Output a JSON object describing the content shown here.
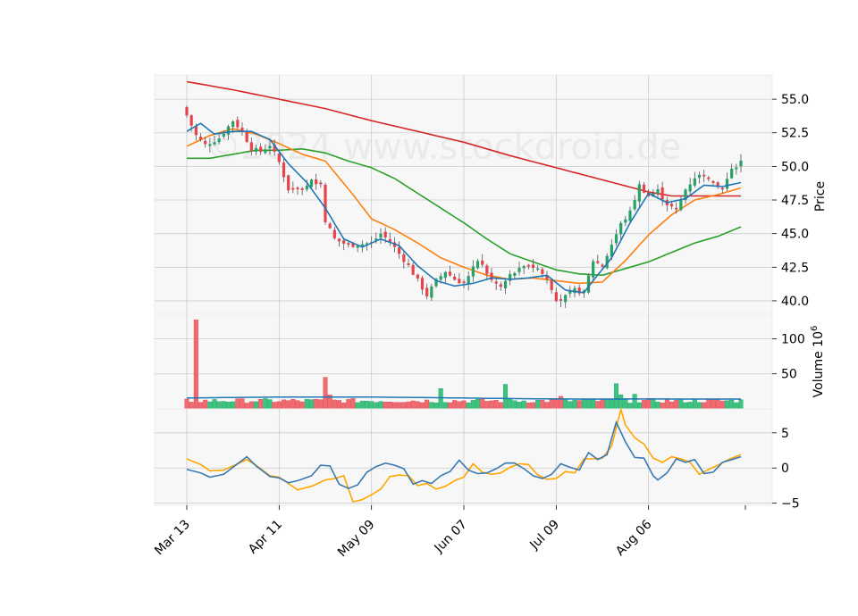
{
  "chart_data": {
    "type": "candlestick",
    "watermark": "©2024 www.stockdroid.de",
    "grid": true,
    "x_tick_labels": [
      "Mar 13",
      "Apr 11",
      "May 09",
      "Jun 07",
      "Jul 09",
      "Aug 06"
    ],
    "x_tick_sessions": [
      0,
      20,
      40,
      60,
      80,
      100
    ],
    "sessions": 120,
    "panels": {
      "price": {
        "ylabel": "Price",
        "ylim": [
          39.0,
          56.8
        ],
        "yticks": [
          40.0,
          42.5,
          45.0,
          47.5,
          50.0,
          52.5,
          55.0
        ],
        "tick_labels": [
          "40.0",
          "42.5",
          "45.0",
          "47.5",
          "50.0",
          "52.5",
          "55.0"
        ]
      },
      "volume": {
        "ylabel": "Volume  10",
        "ylabel_exponent": "6",
        "ylim": [
          0,
          135
        ],
        "yticks": [
          50,
          100
        ],
        "tick_labels": [
          "50",
          "100"
        ]
      },
      "oscillator": {
        "ylim": [
          -5.3,
          8.4
        ],
        "yticks": [
          -5,
          0,
          5
        ],
        "tick_labels": [
          "−5",
          "0",
          "5"
        ]
      }
    },
    "colors": {
      "up": "#26a269",
      "down": "#e8434b",
      "volume_up": "#3bc47f",
      "volume_down": "#f06a70",
      "ma_short": "#1f77b4",
      "ma_mid": "#ff7f0e",
      "ma_long": "#2ca02c",
      "ma_200": "#d62728",
      "volume_avg": "#1f77b4",
      "osc_fast": "#ffa500",
      "osc_slow": "#3a7ab0"
    },
    "close_anchors": [
      [
        0,
        53.8
      ],
      [
        2,
        52.3
      ],
      [
        4,
        51.6
      ],
      [
        7,
        52.1
      ],
      [
        10,
        53.4
      ],
      [
        12,
        52.6
      ],
      [
        14,
        51.3
      ],
      [
        16,
        51.1
      ],
      [
        18,
        51.6
      ],
      [
        20,
        50.3
      ],
      [
        22,
        48.3
      ],
      [
        25,
        48.1
      ],
      [
        27,
        48.9
      ],
      [
        29,
        48.8
      ],
      [
        30,
        46.0
      ],
      [
        32,
        44.6
      ],
      [
        35,
        44.1
      ],
      [
        37,
        44.2
      ],
      [
        40,
        44.3
      ],
      [
        42,
        45.0
      ],
      [
        44,
        44.4
      ],
      [
        46,
        43.5
      ],
      [
        48,
        42.6
      ],
      [
        50,
        41.5
      ],
      [
        52,
        40.4
      ],
      [
        54,
        41.5
      ],
      [
        56,
        42.2
      ],
      [
        58,
        41.6
      ],
      [
        60,
        41.3
      ],
      [
        62,
        42.4
      ],
      [
        63,
        43.0
      ],
      [
        64,
        42.6
      ],
      [
        66,
        41.5
      ],
      [
        68,
        41.0
      ],
      [
        70,
        41.9
      ],
      [
        72,
        42.3
      ],
      [
        74,
        42.6
      ],
      [
        76,
        42.4
      ],
      [
        78,
        41.6
      ],
      [
        80,
        40.0
      ],
      [
        82,
        40.3
      ],
      [
        84,
        40.8
      ],
      [
        86,
        40.6
      ],
      [
        88,
        43.0
      ],
      [
        90,
        42.6
      ],
      [
        92,
        44.2
      ],
      [
        94,
        45.7
      ],
      [
        96,
        46.6
      ],
      [
        98,
        48.6
      ],
      [
        100,
        47.8
      ],
      [
        102,
        48.2
      ],
      [
        104,
        47.2
      ],
      [
        106,
        46.7
      ],
      [
        108,
        48.3
      ],
      [
        110,
        49.2
      ],
      [
        112,
        49.4
      ],
      [
        114,
        48.6
      ],
      [
        116,
        48.3
      ],
      [
        118,
        49.7
      ],
      [
        120,
        50.4
      ]
    ],
    "ma_short_anchors": [
      [
        0,
        52.6
      ],
      [
        3,
        53.2
      ],
      [
        6,
        52.4
      ],
      [
        10,
        52.6
      ],
      [
        14,
        52.6
      ],
      [
        18,
        52.0
      ],
      [
        22,
        50.2
      ],
      [
        26,
        48.8
      ],
      [
        30,
        46.9
      ],
      [
        34,
        44.6
      ],
      [
        38,
        44.0
      ],
      [
        42,
        44.6
      ],
      [
        46,
        44.1
      ],
      [
        50,
        42.6
      ],
      [
        54,
        41.5
      ],
      [
        58,
        41.1
      ],
      [
        62,
        41.3
      ],
      [
        66,
        41.7
      ],
      [
        70,
        41.6
      ],
      [
        74,
        41.7
      ],
      [
        78,
        41.9
      ],
      [
        82,
        40.8
      ],
      [
        86,
        40.6
      ],
      [
        88,
        41.5
      ],
      [
        92,
        43.2
      ],
      [
        96,
        45.8
      ],
      [
        100,
        48.0
      ],
      [
        104,
        47.3
      ],
      [
        108,
        47.6
      ],
      [
        112,
        48.6
      ],
      [
        116,
        48.5
      ],
      [
        120,
        48.8
      ]
    ],
    "ma_mid_anchors": [
      [
        0,
        51.5
      ],
      [
        5,
        52.3
      ],
      [
        10,
        52.8
      ],
      [
        15,
        52.4
      ],
      [
        20,
        51.7
      ],
      [
        25,
        50.9
      ],
      [
        30,
        50.4
      ],
      [
        36,
        47.9
      ],
      [
        40,
        46.1
      ],
      [
        45,
        45.3
      ],
      [
        50,
        44.3
      ],
      [
        55,
        43.2
      ],
      [
        60,
        42.5
      ],
      [
        65,
        41.9
      ],
      [
        70,
        41.6
      ],
      [
        75,
        41.7
      ],
      [
        80,
        41.5
      ],
      [
        85,
        41.3
      ],
      [
        90,
        41.4
      ],
      [
        95,
        43.0
      ],
      [
        100,
        44.9
      ],
      [
        105,
        46.4
      ],
      [
        110,
        47.5
      ],
      [
        115,
        47.9
      ],
      [
        120,
        48.4
      ]
    ],
    "ma_long_anchors": [
      [
        0,
        50.6
      ],
      [
        5,
        50.6
      ],
      [
        10,
        50.9
      ],
      [
        15,
        51.2
      ],
      [
        20,
        51.2
      ],
      [
        25,
        51.3
      ],
      [
        30,
        51.0
      ],
      [
        35,
        50.4
      ],
      [
        40,
        49.9
      ],
      [
        45,
        49.1
      ],
      [
        50,
        48.0
      ],
      [
        55,
        46.9
      ],
      [
        60,
        45.8
      ],
      [
        65,
        44.6
      ],
      [
        70,
        43.5
      ],
      [
        75,
        42.9
      ],
      [
        80,
        42.3
      ],
      [
        85,
        42.0
      ],
      [
        90,
        41.9
      ],
      [
        95,
        42.4
      ],
      [
        100,
        42.9
      ],
      [
        105,
        43.6
      ],
      [
        110,
        44.3
      ],
      [
        115,
        44.8
      ],
      [
        120,
        45.5
      ]
    ],
    "ma_200_anchors": [
      [
        0,
        56.3
      ],
      [
        10,
        55.7
      ],
      [
        20,
        55.0
      ],
      [
        30,
        54.3
      ],
      [
        40,
        53.4
      ],
      [
        50,
        52.6
      ],
      [
        60,
        51.8
      ],
      [
        70,
        50.8
      ],
      [
        80,
        49.9
      ],
      [
        90,
        49.0
      ],
      [
        100,
        48.1
      ],
      [
        105,
        47.8
      ],
      [
        110,
        47.8
      ],
      [
        120,
        47.8
      ]
    ],
    "volume_spikes": [
      [
        0,
        14
      ],
      [
        2,
        127
      ],
      [
        30,
        45
      ],
      [
        31,
        20
      ],
      [
        55,
        29
      ],
      [
        69,
        35
      ],
      [
        81,
        18
      ],
      [
        93,
        36
      ],
      [
        94,
        20
      ],
      [
        97,
        21
      ]
    ],
    "volume_baseline": 11,
    "volume_avg": 15.5,
    "osc_fast_anchors": [
      [
        0,
        1.3
      ],
      [
        3,
        0.5
      ],
      [
        5,
        -0.4
      ],
      [
        8,
        -0.3
      ],
      [
        11,
        0.6
      ],
      [
        13,
        1.2
      ],
      [
        15,
        0.4
      ],
      [
        18,
        -1.1
      ],
      [
        20,
        -1.3
      ],
      [
        22,
        -2.2
      ],
      [
        24,
        -3.1
      ],
      [
        27,
        -2.6
      ],
      [
        30,
        -1.7
      ],
      [
        32,
        -1.5
      ],
      [
        34,
        -1.1
      ],
      [
        36,
        -4.8
      ],
      [
        38,
        -4.5
      ],
      [
        40,
        -3.8
      ],
      [
        42,
        -3.0
      ],
      [
        44,
        -1.2
      ],
      [
        46,
        -1.0
      ],
      [
        48,
        -1.1
      ],
      [
        50,
        -2.5
      ],
      [
        52,
        -2.2
      ],
      [
        54,
        -3.0
      ],
      [
        56,
        -2.6
      ],
      [
        58,
        -1.8
      ],
      [
        60,
        -1.3
      ],
      [
        62,
        0.6
      ],
      [
        64,
        -0.6
      ],
      [
        66,
        -0.9
      ],
      [
        68,
        -0.7
      ],
      [
        70,
        0.1
      ],
      [
        72,
        0.6
      ],
      [
        74,
        0.5
      ],
      [
        76,
        -1.0
      ],
      [
        78,
        -1.6
      ],
      [
        80,
        -1.5
      ],
      [
        82,
        -0.5
      ],
      [
        84,
        -0.7
      ],
      [
        86,
        1.3
      ],
      [
        88,
        1.3
      ],
      [
        90,
        1.4
      ],
      [
        92,
        3.1
      ],
      [
        94,
        8.3
      ],
      [
        95,
        6.1
      ],
      [
        97,
        4.3
      ],
      [
        99,
        3.4
      ],
      [
        101,
        1.4
      ],
      [
        103,
        0.8
      ],
      [
        105,
        1.6
      ],
      [
        107,
        1.3
      ],
      [
        109,
        0.8
      ],
      [
        111,
        -0.9
      ],
      [
        113,
        -0.2
      ],
      [
        115,
        0.4
      ],
      [
        117,
        1.1
      ],
      [
        120,
        1.9
      ]
    ],
    "osc_slow_anchors": [
      [
        0,
        -0.2
      ],
      [
        3,
        -0.7
      ],
      [
        5,
        -1.3
      ],
      [
        8,
        -0.9
      ],
      [
        11,
        0.6
      ],
      [
        13,
        1.6
      ],
      [
        15,
        0.3
      ],
      [
        18,
        -1.2
      ],
      [
        20,
        -1.4
      ],
      [
        22,
        -2.1
      ],
      [
        24,
        -1.8
      ],
      [
        27,
        -1.1
      ],
      [
        29,
        0.4
      ],
      [
        31,
        0.3
      ],
      [
        33,
        -2.3
      ],
      [
        35,
        -2.9
      ],
      [
        37,
        -2.4
      ],
      [
        39,
        -0.6
      ],
      [
        41,
        0.2
      ],
      [
        43,
        0.7
      ],
      [
        45,
        0.4
      ],
      [
        47,
        -0.1
      ],
      [
        49,
        -2.3
      ],
      [
        51,
        -1.8
      ],
      [
        53,
        -2.2
      ],
      [
        55,
        -1.1
      ],
      [
        57,
        -0.5
      ],
      [
        59,
        1.1
      ],
      [
        61,
        -0.3
      ],
      [
        63,
        -0.8
      ],
      [
        65,
        -0.7
      ],
      [
        67,
        -0.1
      ],
      [
        69,
        0.7
      ],
      [
        71,
        0.7
      ],
      [
        73,
        -0.1
      ],
      [
        75,
        -1.1
      ],
      [
        77,
        -1.5
      ],
      [
        79,
        -0.9
      ],
      [
        81,
        0.6
      ],
      [
        83,
        0.1
      ],
      [
        85,
        -0.3
      ],
      [
        87,
        2.2
      ],
      [
        89,
        1.2
      ],
      [
        91,
        1.9
      ],
      [
        93,
        6.5
      ],
      [
        95,
        3.7
      ],
      [
        97,
        1.5
      ],
      [
        99,
        1.4
      ],
      [
        101,
        -1.1
      ],
      [
        102,
        -1.7
      ],
      [
        104,
        -0.7
      ],
      [
        106,
        1.3
      ],
      [
        108,
        0.8
      ],
      [
        110,
        1.2
      ],
      [
        112,
        -0.8
      ],
      [
        114,
        -0.6
      ],
      [
        116,
        0.8
      ],
      [
        118,
        1.2
      ],
      [
        120,
        1.6
      ]
    ]
  }
}
